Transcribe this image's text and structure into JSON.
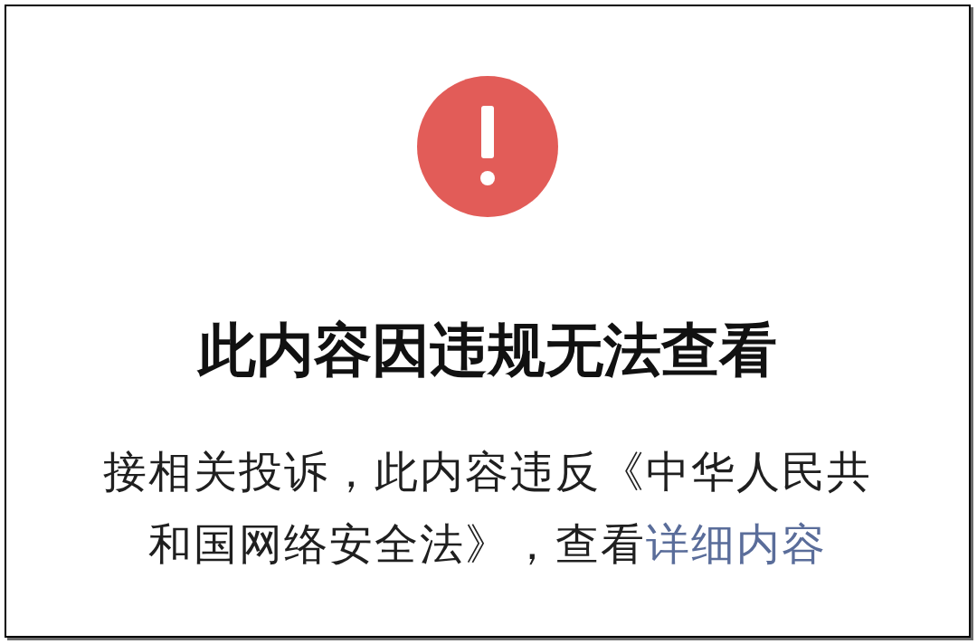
{
  "notice": {
    "title": "此内容因违规无法查看",
    "message": "接相关投诉，此内容违反《中华人民共和国网络安全法》，查看",
    "link": "详细内容"
  }
}
